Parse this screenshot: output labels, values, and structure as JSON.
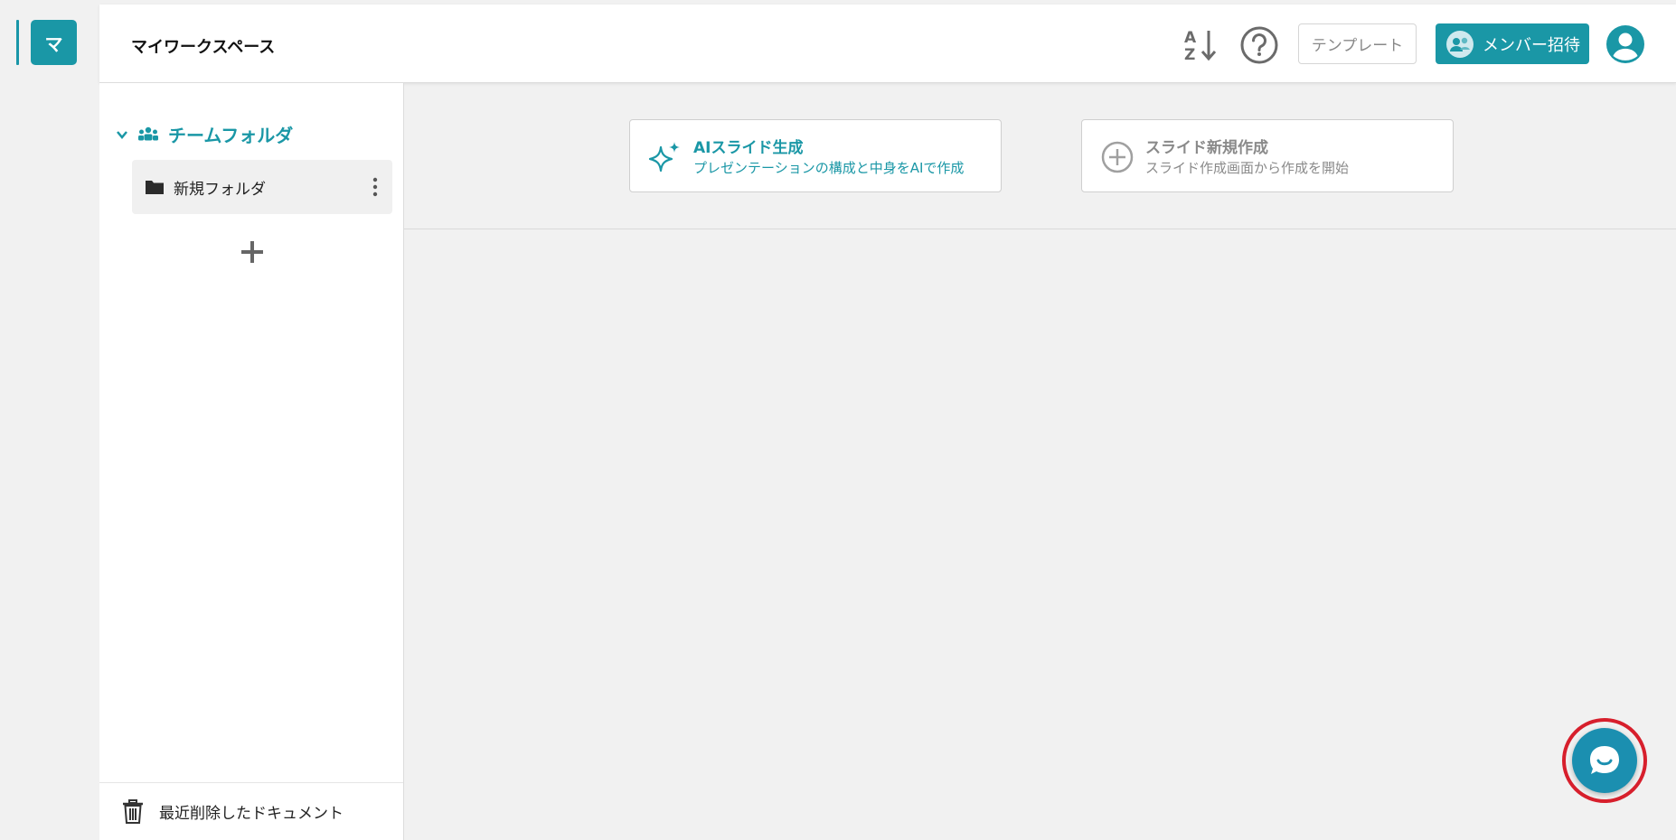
{
  "rail": {
    "workspace_initial": "マ"
  },
  "topbar": {
    "workspace_title": "マイワークスペース",
    "sort_icon": "sort-alpha-icon",
    "help_icon": "help-circle-icon",
    "template_label": "テンプレート",
    "invite_label": "メンバー招待"
  },
  "sidebar": {
    "team_label": "チームフォルダ",
    "folders": [
      {
        "name": "新規フォルダ"
      }
    ],
    "trash_label": "最近削除したドキュメント"
  },
  "cards": {
    "ai": {
      "title": "AIスライド生成",
      "subtitle": "プレゼンテーションの構成と中身をAIで作成"
    },
    "new": {
      "title": "スライド新規作成",
      "subtitle": "スライド作成画面から作成を開始"
    }
  },
  "colors": {
    "accent": "#1a97a6",
    "chat": "#1b8fb0",
    "highlight_ring": "#d71f2c"
  }
}
